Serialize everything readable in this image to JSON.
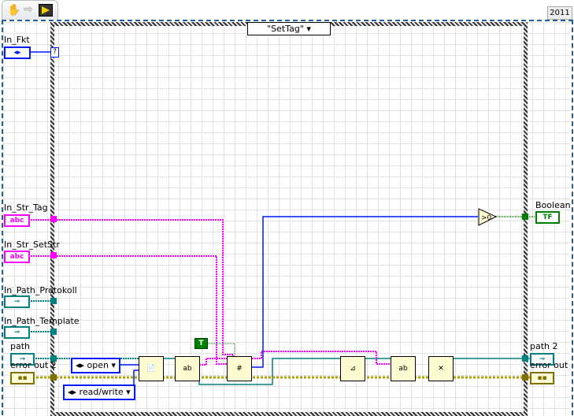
{
  "toolbar": {
    "version": "2011",
    "hand_icon": "hand-icon",
    "arrow_icon": "arrow-icon",
    "run_icon": "run-icon"
  },
  "case": {
    "selector": "\"SetTag\""
  },
  "controls": [
    {
      "label": "In_Fkt",
      "glyph": "◂▸"
    },
    {
      "label": "In_Str_Tag",
      "glyph": "abc"
    },
    {
      "label": "In_Str_SetStr",
      "glyph": "abc"
    },
    {
      "label": "In_Path_Protokoll",
      "glyph": "⊸"
    },
    {
      "label": "In_Path_Template",
      "glyph": "⊸"
    },
    {
      "label": "path",
      "glyph": "⊸"
    },
    {
      "label": "error out 2",
      "glyph": "▪▪"
    }
  ],
  "indicators": [
    {
      "label": "Boolean",
      "glyph": "TF"
    },
    {
      "label": "path 2",
      "glyph": "⊸"
    },
    {
      "label": "error out",
      "glyph": "▪▪"
    }
  ],
  "constants": {
    "open": "open",
    "read_write": "read/write",
    "true": "T",
    "case_tunnel": "?"
  },
  "nodes": {
    "open_file": "📄",
    "read_text": "ab",
    "subvi": "#",
    "set_file_pos": "⊿",
    "write_text": "ab",
    "close_file": "✕",
    "greater_zero": ">0"
  }
}
